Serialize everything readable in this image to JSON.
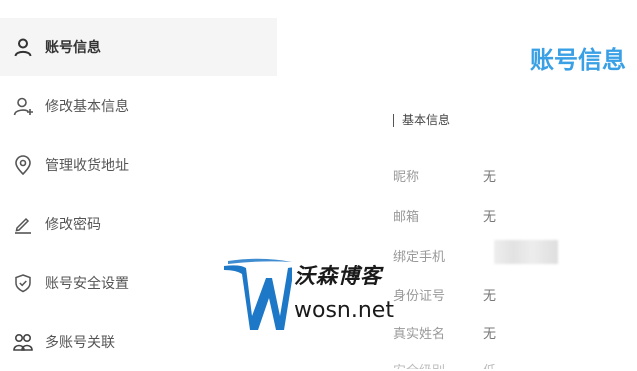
{
  "sidebar": {
    "items": [
      {
        "label": "账号信息",
        "icon": "user-icon",
        "active": true
      },
      {
        "label": "修改基本信息",
        "icon": "user-edit-icon",
        "active": false
      },
      {
        "label": "管理收货地址",
        "icon": "location-pin-icon",
        "active": false
      },
      {
        "label": "修改密码",
        "icon": "pencil-icon",
        "active": false
      },
      {
        "label": "账号安全设置",
        "icon": "shield-check-icon",
        "active": false
      },
      {
        "label": "多账号关联",
        "icon": "linked-accounts-icon",
        "active": false
      }
    ]
  },
  "main": {
    "title": "账号信息",
    "section_title": "基本信息",
    "fields": [
      {
        "label": "昵称",
        "value": "无"
      },
      {
        "label": "邮箱",
        "value": "无"
      },
      {
        "label": "绑定手机",
        "value": ""
      },
      {
        "label": "身份证号",
        "value": "无"
      },
      {
        "label": "真实姓名",
        "value": "无"
      }
    ],
    "partial_field": {
      "label": "安全级别",
      "value": "低"
    }
  },
  "watermark": {
    "name": "沃森博客",
    "url": "wosn.net",
    "logo_letter": "W"
  },
  "colors": {
    "accent": "#3aa0e6",
    "active_bg": "#f5f5f5",
    "watermark_blue": "#1e78c8"
  }
}
